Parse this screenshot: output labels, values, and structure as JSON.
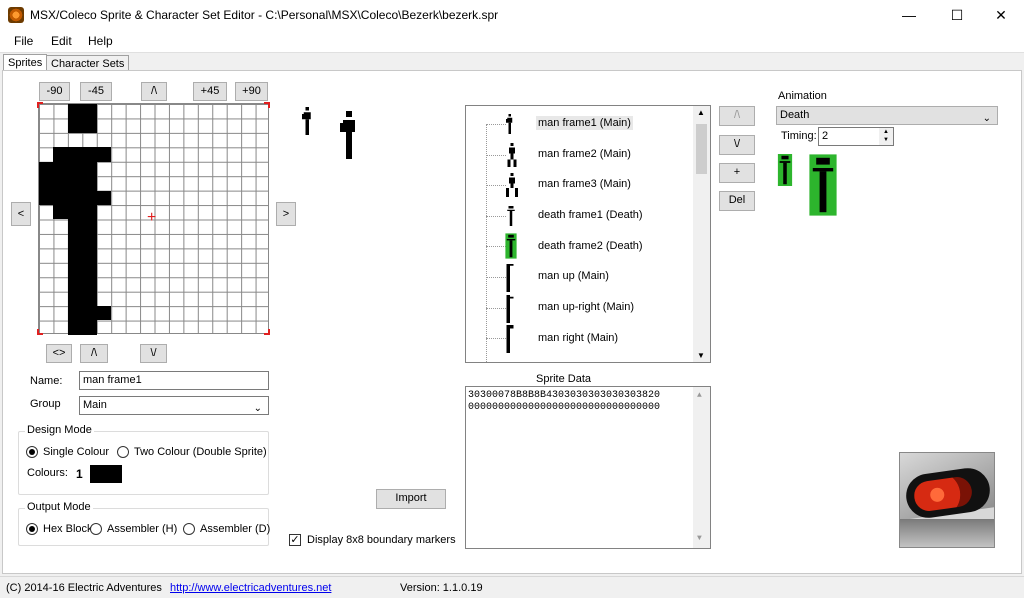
{
  "window": {
    "title": "MSX/Coleco Sprite & Character Set Editor - C:\\Personal\\MSX\\Coleco\\Bezerk\\bezerk.spr",
    "minimize": "—",
    "maximize": "☐",
    "close": "✕"
  },
  "menu": [
    "File",
    "Edit",
    "Help"
  ],
  "tabs": [
    "Sprites",
    "Character Sets"
  ],
  "rotate_buttons": [
    "-90",
    "-45",
    "/\\",
    "+45",
    "+90"
  ],
  "shift_left": "<",
  "shift_right": ">",
  "flip_buttons": [
    "<>",
    "/\\",
    "\\/"
  ],
  "name_label": "Name:",
  "name_value": "man frame1",
  "group_label": "Group",
  "group_value": "Main",
  "design_mode": {
    "title": "Design Mode",
    "single": "Single Colour",
    "double": "Two Colour (Double Sprite)",
    "colours_label": "Colours:",
    "colour_index": "1",
    "colour_hex": "#000000"
  },
  "output_mode": {
    "title": "Output Mode",
    "options": [
      "Hex Block",
      "Assembler (H)",
      "Assembler (D)"
    ]
  },
  "import_label": "Import",
  "boundary_label": "Display 8x8 boundary markers",
  "sprite_list": [
    "man frame1 (Main)",
    "man frame2 (Main)",
    "man frame3 (Main)",
    "death frame1 (Death)",
    "death frame2 (Death)",
    "man up (Main)",
    "man up-right (Main)",
    "man right (Main)"
  ],
  "list_buttons": [
    "/\\",
    "\\/",
    "+",
    "Del"
  ],
  "sprite_data": {
    "title": "Sprite Data",
    "lines": [
      "30300078B8B8B4303030303030303820",
      "00000000000000000000000000000000"
    ]
  },
  "animation": {
    "title": "Animation",
    "selected": "Death",
    "timing_label": "Timing:",
    "timing_value": "2",
    "highlight_color": "#2db52d"
  },
  "status": {
    "copyright": "(C) 2014-16 Electric Adventures",
    "url": "http://www.electricadventures.net",
    "version": "Version: 1.1.0.19"
  }
}
